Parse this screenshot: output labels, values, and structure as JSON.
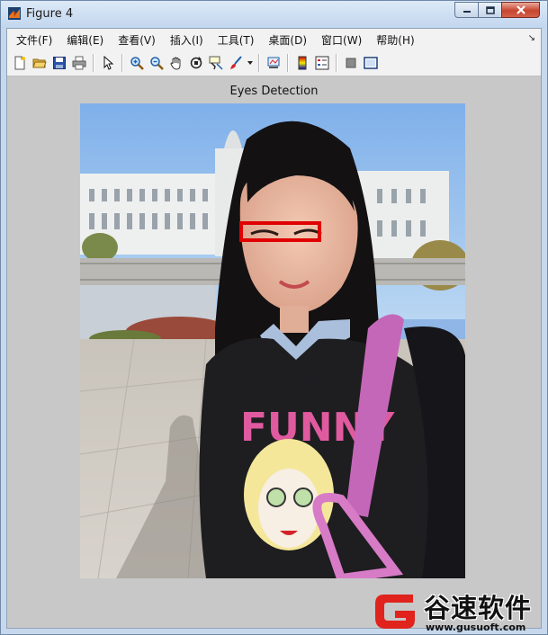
{
  "window": {
    "title": "Figure 4",
    "minimize_icon": "minimize-icon",
    "maximize_icon": "maximize-icon",
    "close_icon": "close-icon"
  },
  "menu": {
    "items": [
      {
        "label": "文件(F)"
      },
      {
        "label": "编辑(E)"
      },
      {
        "label": "查看(V)"
      },
      {
        "label": "插入(I)"
      },
      {
        "label": "工具(T)"
      },
      {
        "label": "桌面(D)"
      },
      {
        "label": "窗口(W)"
      },
      {
        "label": "帮助(H)"
      }
    ],
    "corner_glyph": "↘"
  },
  "toolbar": {
    "buttons": [
      "new-figure-icon",
      "open-file-icon",
      "save-icon",
      "print-icon",
      "pointer-icon",
      "zoom-in-icon",
      "zoom-out-icon",
      "pan-hand-icon",
      "rotate-3d-icon",
      "data-cursor-icon",
      "brush-icon",
      "link-plot-icon",
      "colorbar-icon",
      "legend-icon",
      "hide-plot-tools-icon",
      "show-plot-tools-icon"
    ]
  },
  "axes": {
    "title": "Eyes Detection",
    "detection_box_color": "#e00000"
  },
  "watermark": {
    "name": "谷速软件",
    "url": "www.gusuoft.com",
    "logo_color": "#e0231c"
  }
}
